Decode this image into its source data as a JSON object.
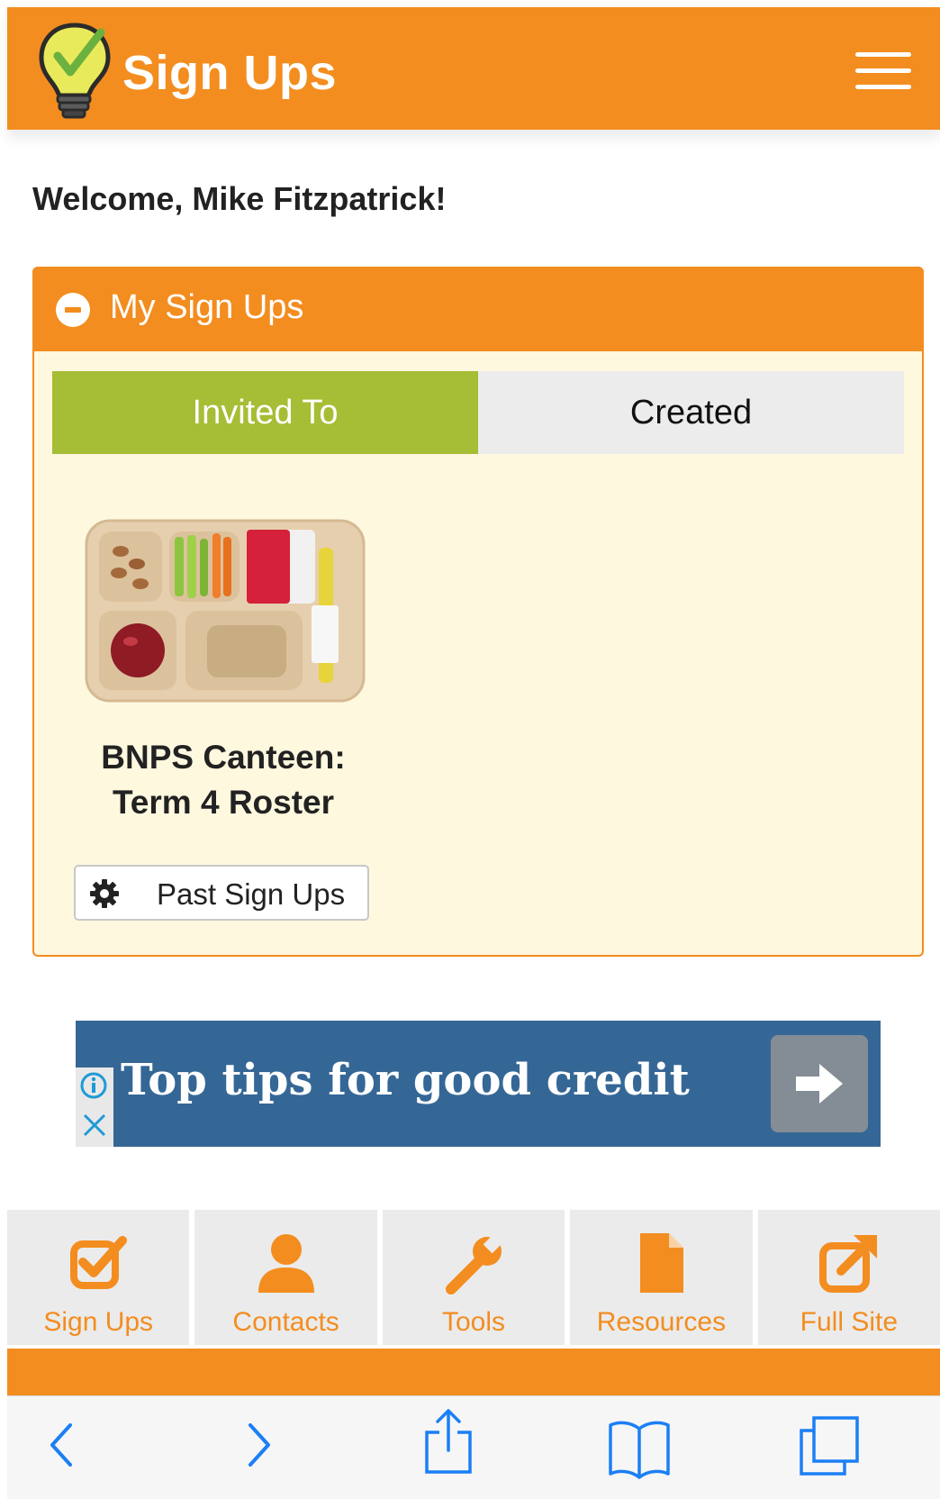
{
  "header": {
    "title": "Sign Ups",
    "brand_color": "#f38d1f"
  },
  "welcome": "Welcome, Mike Fitzpatrick!",
  "panel": {
    "title": "My Sign Ups",
    "tabs": [
      {
        "label": "Invited To",
        "active": true
      },
      {
        "label": "Created",
        "active": false
      }
    ],
    "signup_card": {
      "title": "BNPS Canteen: Term 4 Roster"
    },
    "past_button_label": "Past Sign Ups",
    "background": "#fef8df"
  },
  "ad": {
    "text": "Top tips for good credit",
    "background": "#356796"
  },
  "bottom_nav": [
    {
      "label": "Sign Ups",
      "icon": "checkbox-icon"
    },
    {
      "label": "Contacts",
      "icon": "person-icon"
    },
    {
      "label": "Tools",
      "icon": "wrench-icon"
    },
    {
      "label": "Resources",
      "icon": "document-icon"
    },
    {
      "label": "Full Site",
      "icon": "external-link-icon"
    }
  ],
  "browser_toolbar": [
    "back-icon",
    "forward-icon",
    "share-icon",
    "bookmarks-icon",
    "tabs-icon"
  ],
  "colors": {
    "accent": "#f38d1f",
    "tab_active": "#a6bd36",
    "browser_icon": "#1b7ff5"
  }
}
